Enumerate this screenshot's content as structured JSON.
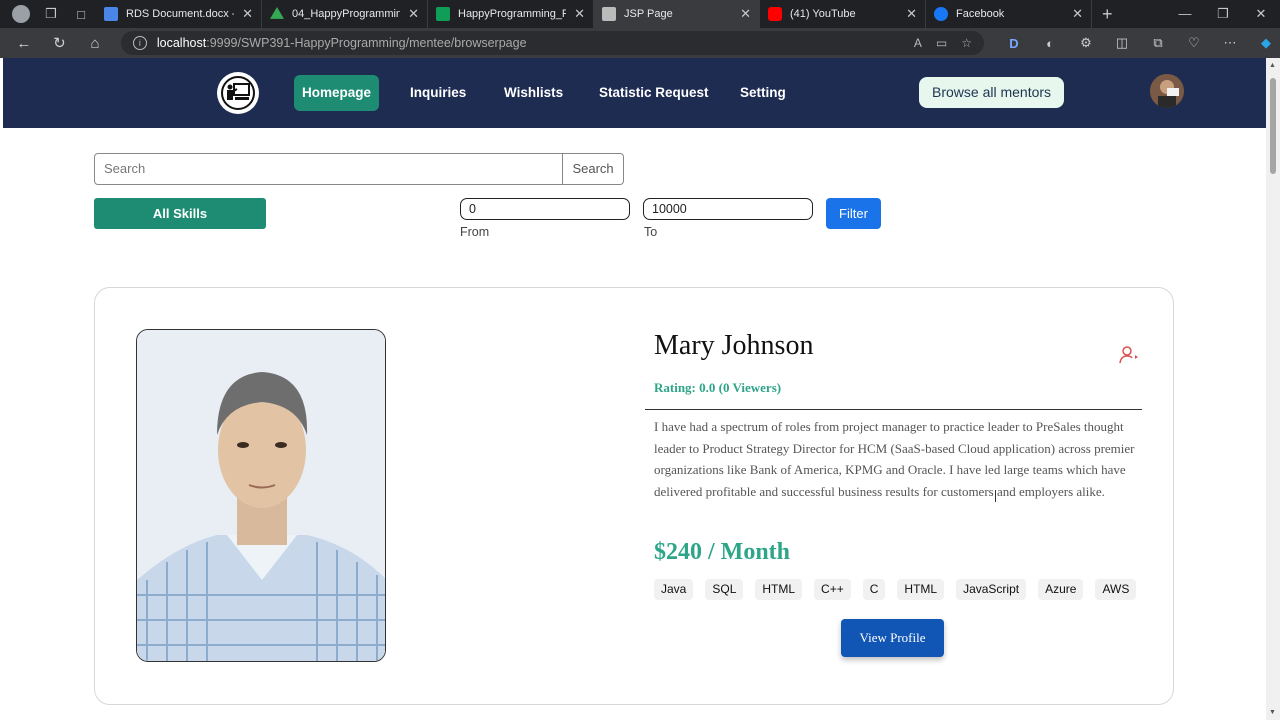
{
  "browser": {
    "tabs": [
      {
        "title": "RDS Document.docx - Go",
        "favicon_color": "#4a86e8"
      },
      {
        "title": "04_HappyProgramming -",
        "favicon_color": "#34a853"
      },
      {
        "title": "HappyProgramming_Fun",
        "favicon_color": "#0f9d58"
      },
      {
        "title": "JSP Page",
        "favicon_color": "#bbbbbb",
        "active": true
      },
      {
        "title": "(41) YouTube",
        "favicon_color": "#ff0000"
      },
      {
        "title": "Facebook",
        "favicon_color": "#1877f2"
      }
    ],
    "url_host": "localhost",
    "url_path": ":9999/SWP391-HappyProgramming/mentee/browserpage",
    "profile_letter": "D"
  },
  "navbar": {
    "items": [
      {
        "label": "Homepage",
        "active": true
      },
      {
        "label": "Inquiries"
      },
      {
        "label": "Wishlists"
      },
      {
        "label": "Statistic Request"
      },
      {
        "label": "Setting"
      }
    ],
    "browse_label": "Browse all mentors",
    "bg_color": "#1e2c52",
    "accent_color": "#1e8c72"
  },
  "search": {
    "placeholder": "Search",
    "button_label": "Search"
  },
  "filters": {
    "all_skills_label": "All Skills",
    "from_value": "0",
    "from_label": "From",
    "to_value": "10000",
    "to_label": "To",
    "filter_label": "Filter"
  },
  "mentor": {
    "name": "Mary Johnson",
    "rating": "Rating: 0.0 (0 Viewers)",
    "bio": "I have had a spectrum of roles from project manager to practice leader to PreSales thought leader to Product Strategy Director for HCM (SaaS-based Cloud application) across premier organizations like Bank of America, KPMG and Oracle. I have led large teams which have delivered profitable and successful business results for customers and employers alike.",
    "price": "$240 / Month",
    "skills": [
      "Java",
      "SQL",
      "HTML",
      "C++",
      "C",
      "HTML",
      "JavaScript",
      "Azure",
      "AWS"
    ],
    "view_label": "View Profile"
  }
}
